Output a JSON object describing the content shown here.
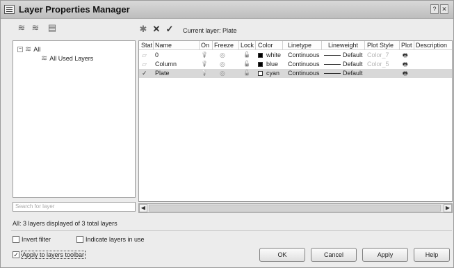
{
  "window": {
    "title": "Layer Properties Manager",
    "help_glyph": "?",
    "close_glyph": "✕"
  },
  "toolbar_left": [
    {
      "name": "new-property-filter-icon",
      "glyph": "≋"
    },
    {
      "name": "new-group-filter-icon",
      "glyph": "≋"
    },
    {
      "name": "layer-states-manager-icon",
      "glyph": "▤"
    }
  ],
  "toolbar_right": [
    {
      "name": "new-layer-icon",
      "glyph": "✱"
    },
    {
      "name": "delete-layer-icon",
      "glyph": "✕"
    },
    {
      "name": "set-current-icon",
      "glyph": "✓"
    }
  ],
  "current_layer_label": "Current layer: Plate",
  "tree": {
    "root_label": "All",
    "root_expander": "−",
    "child_label": "All Used Layers"
  },
  "search": {
    "placeholder": "Search for layer"
  },
  "columns": [
    "Stat",
    "Name",
    "On",
    "Freeze",
    "Lock",
    "Color",
    "Linetype",
    "Lineweight",
    "Plot Style",
    "Plot",
    "Description"
  ],
  "layers": [
    {
      "status": "▱",
      "name": "0",
      "on": "💡",
      "freeze": "◎",
      "lock": "🔓",
      "color_hex": "#000000",
      "color": "white",
      "linetype": "Continuous",
      "lineweight": "Default",
      "plot_style": "Color_7",
      "plot": "🖶",
      "selected": false
    },
    {
      "status": "▱",
      "name": "Column",
      "on": "💡",
      "freeze": "◎",
      "lock": "🔓",
      "color_hex": "#000000",
      "color": "blue",
      "linetype": "Continuous",
      "lineweight": "Default",
      "plot_style": "Color_5",
      "plot": "🖶",
      "selected": false
    },
    {
      "status": "✓",
      "name": "Plate",
      "on": "💡",
      "freeze": "◎",
      "lock": "🔓",
      "color_hex": "#ffffff",
      "color": "cyan",
      "linetype": "Continuous",
      "lineweight": "Default",
      "plot_style": "",
      "plot": "🖶",
      "selected": true
    }
  ],
  "scroll": {
    "left": "◀",
    "right": "▶"
  },
  "status_text": "All: 3 layers displayed of 3 total layers",
  "options": {
    "invert_filter": {
      "label": "Invert filter",
      "checked": false
    },
    "indicate_in_use": {
      "label": "Indicate layers in use",
      "checked": false
    },
    "apply_toolbar": {
      "label": "Apply to layers toolbar",
      "checked": true
    }
  },
  "buttons": {
    "ok": "OK",
    "cancel": "Cancel",
    "apply": "Apply",
    "help": "Help"
  }
}
